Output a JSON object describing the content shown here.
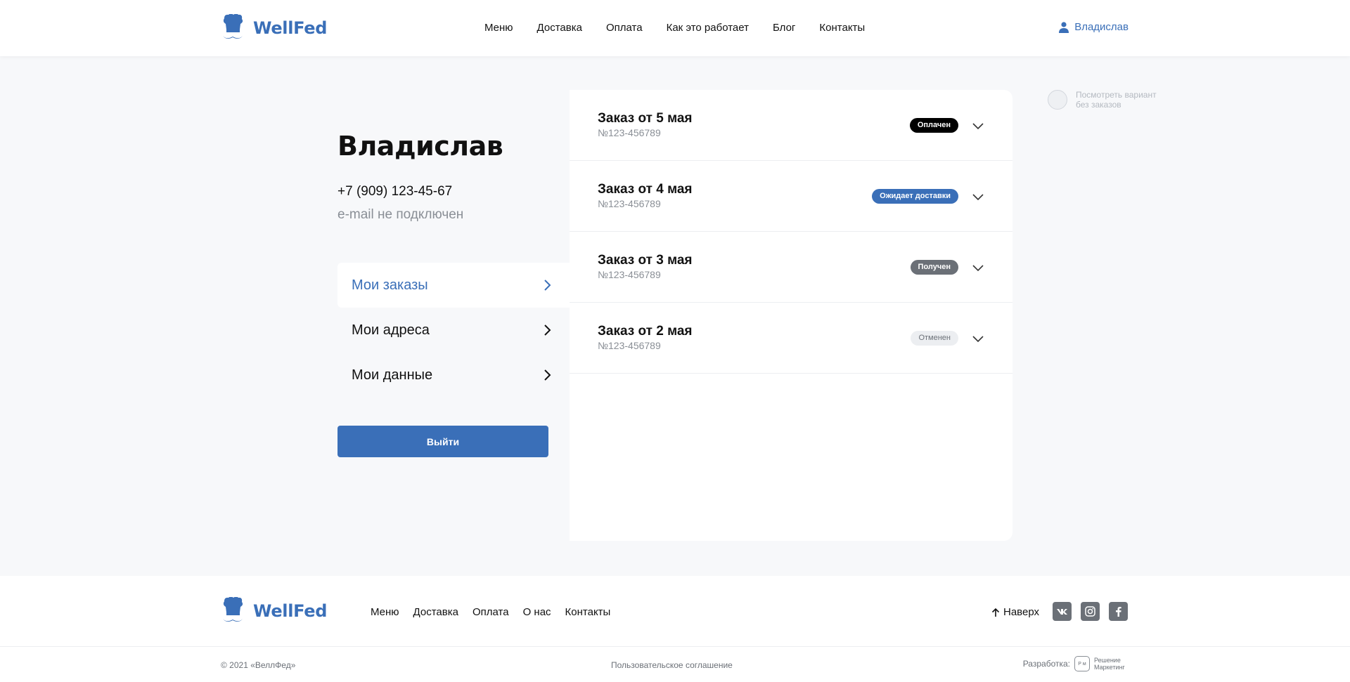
{
  "header": {
    "brand": "WellFed",
    "nav": [
      "Меню",
      "Доставка",
      "Оплата",
      "Как это работает",
      "Блог",
      "Контакты"
    ],
    "user_name": "Владислав"
  },
  "profile": {
    "name": "Владислав",
    "phone": "+7 (909) 123-45-67",
    "email": "e-mail не подключен",
    "menu": [
      {
        "label": "Мои заказы",
        "active": true
      },
      {
        "label": "Мои адреса",
        "active": false
      },
      {
        "label": "Мои данные",
        "active": false
      }
    ],
    "logout_label": "Выйти"
  },
  "orders": [
    {
      "title": "Заказ от 5 мая",
      "number": "№123-456789",
      "status": "Оплачен"
    },
    {
      "title": "Заказ от 4 мая",
      "number": "№123-456789",
      "status": "Ожидает доставки"
    },
    {
      "title": "Заказ от 3 мая",
      "number": "№123-456789",
      "status": "Получен"
    },
    {
      "title": "Заказ от 2 мая",
      "number": "№123-456789",
      "status": "Отменен"
    }
  ],
  "hint": {
    "line1": "Посмотреть вариант",
    "line2": "без заказов"
  },
  "footer": {
    "brand": "WellFed",
    "nav": [
      "Меню",
      "Доставка",
      "Оплата",
      "О нас",
      "Контакты"
    ],
    "up_label": "Наверх",
    "socials": [
      "vk-icon",
      "instagram-icon",
      "facebook-icon"
    ],
    "copyright": "© 2021 «ВеллФед»",
    "agreement": "Пользовательское соглашение",
    "dev_label": "Разработка:",
    "dev_name_1": "Решение",
    "dev_name_2": "Маркетинг"
  },
  "colors": {
    "accent": "#3a6fb8",
    "status_paid": "#000000",
    "status_waiting": "#3a6fb8",
    "status_received": "#6b7077",
    "status_cancelled": "#eceef1"
  }
}
